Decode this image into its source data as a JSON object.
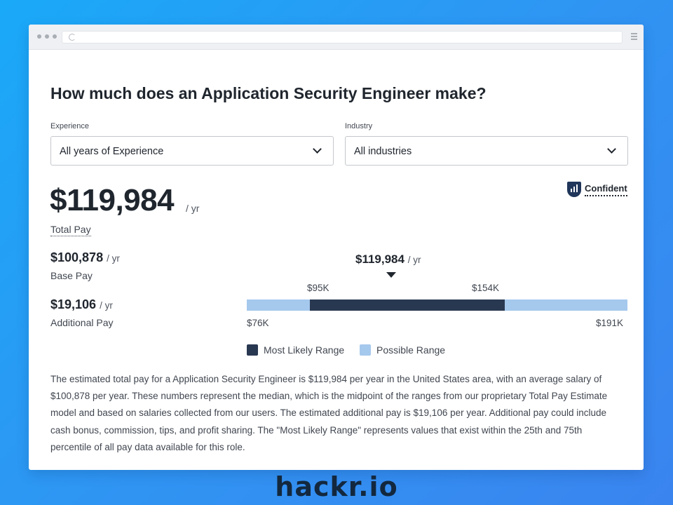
{
  "colors": {
    "background_start": "#1aa9f8",
    "background_end": "#3a84ef",
    "most_likely": "#293851",
    "possible": "#a5c8ed",
    "text_dark": "#20262e"
  },
  "browser": {
    "url": "",
    "controls_icon": "window-dots-icon",
    "reload_icon": "reload-icon",
    "menu_icon": "hamburger-menu-icon"
  },
  "page": {
    "heading": "How much does an Application Security Engineer make?",
    "filters": {
      "experience": {
        "label": "Experience",
        "value": "All years of Experience"
      },
      "industry": {
        "label": "Industry",
        "value": "All industries"
      }
    },
    "confidence": {
      "label": "Confident",
      "icon": "confidence-shield-icon"
    },
    "total_pay": {
      "amount": "$119,984",
      "unit": "/ yr",
      "label": "Total Pay"
    },
    "base_pay": {
      "amount": "$100,878",
      "unit": "/ yr",
      "label": "Base Pay"
    },
    "additional_pay": {
      "amount": "$19,106",
      "unit": "/ yr",
      "label": "Additional Pay"
    },
    "range": {
      "median": {
        "amount": "$119,984",
        "unit": "/ yr",
        "value": 119984
      },
      "likely_low_label": "$95K",
      "likely_high_label": "$154K",
      "possible_low_label": "$76K",
      "possible_high_label": "$191K",
      "likely_low": 95000,
      "likely_high": 154000,
      "possible_low": 76000,
      "possible_high": 191000
    },
    "legend": {
      "most_likely": "Most Likely Range",
      "possible": "Possible Range"
    },
    "description": "The estimated total pay for a Application Security Engineer is $119,984 per year in the United States area, with an average salary of $100,878 per year. These numbers represent the median, which is the midpoint of the ranges from our proprietary Total Pay Estimate model and based on salaries collected from our users. The estimated additional pay is $19,106 per year. Additional pay could include cash bonus, commission, tips, and profit sharing. The \"Most Likely Range\" represents values that exist within the 25th and 75th percentile of all pay data available for this role."
  },
  "brand": "hackr.io"
}
